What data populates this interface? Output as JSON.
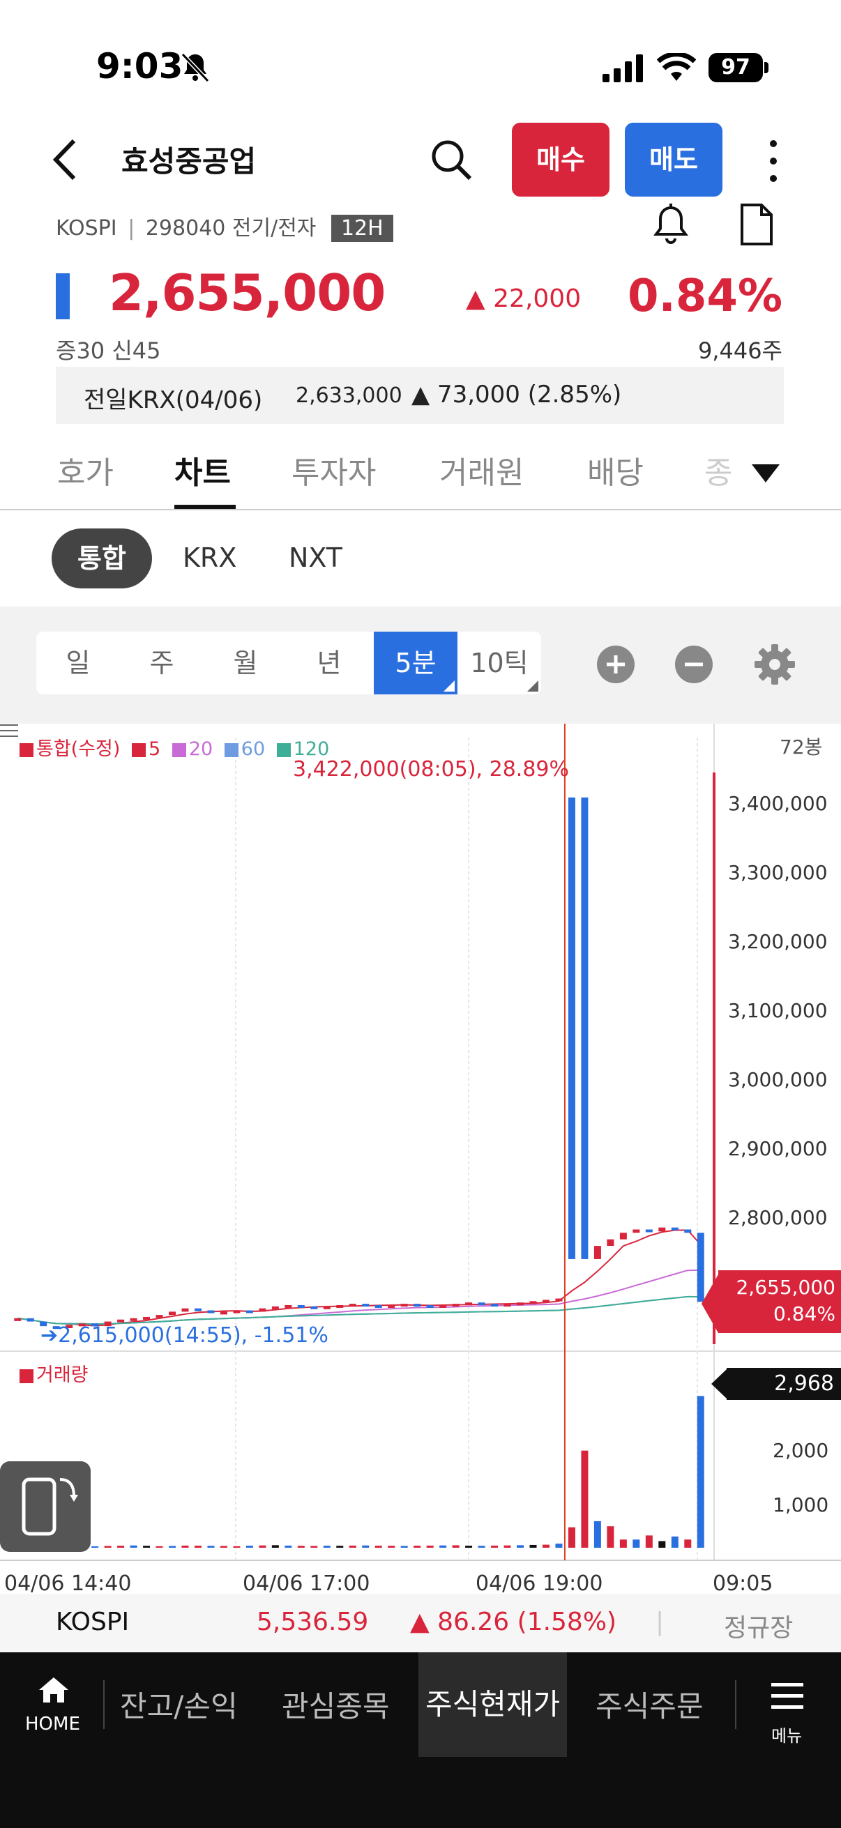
{
  "status": {
    "time": "9:03",
    "battery": "97"
  },
  "header": {
    "title": "효성중공업",
    "buy_label": "매수",
    "sell_label": "매도"
  },
  "sub": {
    "market": "KOSPI",
    "sep": "|",
    "code_sector": "298040 전기/전자",
    "badge": "12H"
  },
  "quote": {
    "price": "2,655,000",
    "change": "▲ 22,000",
    "pct": "0.84%",
    "margin": "증30  신45",
    "volume": "9,446주"
  },
  "prev": {
    "label": "전일KRX(04/06)",
    "price": "2,633,000",
    "change": "▲ 73,000  (2.85%)"
  },
  "tabs": [
    "호가",
    "차트",
    "투자자",
    "거래원",
    "배당",
    "종"
  ],
  "markets": {
    "active": "통합",
    "krx": "KRX",
    "nxt": "NXT"
  },
  "periods": [
    "일",
    "주",
    "월",
    "년",
    "5분",
    "10틱"
  ],
  "chart_data": {
    "type": "candlestick",
    "legend": [
      "통합(수정)",
      "5",
      "20",
      "60",
      "120"
    ],
    "legend_colors": {
      "main": "#d9253b",
      "ma5": "#d9253b",
      "ma20": "#c86bd6",
      "ma60": "#6f9be0",
      "ma120": "#3fae96"
    },
    "bars_label": "72봉",
    "y_ticks": [
      "3,400,000",
      "3,300,000",
      "3,200,000",
      "3,100,000",
      "3,000,000",
      "2,900,000",
      "2,800,000"
    ],
    "ylim": [
      2580000,
      3460000
    ],
    "x_ticks": [
      "04/06 14:40",
      "04/06 17:00",
      "04/06 19:00",
      "09:05"
    ],
    "high_annotation": "3,422,000(08:05), 28.89%",
    "low_annotation": "➔2,615,000(14:55), -1.51%",
    "current_price": "2,655,000",
    "current_pct": "0.84%",
    "volume_label": "거래량",
    "volume_ticks": [
      "2,000",
      "1,000"
    ],
    "volume_current": "2,968",
    "price_series": [
      2630000,
      2625000,
      2618000,
      2615000,
      2620000,
      2622000,
      2618000,
      2625000,
      2628000,
      2630000,
      2632000,
      2635000,
      2640000,
      2645000,
      2642000,
      2638000,
      2640000,
      2642000,
      2640000,
      2645000,
      2648000,
      2650000,
      2648000,
      2645000,
      2648000,
      2650000,
      2652000,
      2650000,
      2648000,
      2650000,
      2652000,
      2650000,
      2648000,
      2650000,
      2652000,
      2654000,
      2652000,
      2650000,
      2652000,
      2654000,
      2656000,
      2658000,
      2660000,
      3422000,
      2720000,
      2740000,
      2750000,
      2760000,
      2765000,
      2762000,
      2768000,
      2765000,
      2760000,
      2655000
    ],
    "volume_series": [
      40,
      35,
      30,
      38,
      42,
      30,
      28,
      35,
      40,
      45,
      38,
      30,
      35,
      42,
      40,
      38,
      35,
      30,
      40,
      45,
      50,
      42,
      38,
      35,
      40,
      38,
      42,
      45,
      40,
      38,
      35,
      40,
      42,
      45,
      48,
      40,
      38,
      42,
      45,
      50,
      55,
      60,
      80,
      400,
      1900,
      520,
      420,
      160,
      160,
      240,
      130,
      220,
      160,
      2968
    ]
  },
  "ticker": {
    "name": "KOSPI",
    "value": "5,536.59",
    "change": "▲ 86.26 (1.58%)",
    "sep": "|",
    "session": "정규장"
  },
  "nav": {
    "home": "HOME",
    "items": [
      "잔고/손익",
      "관심종목",
      "주식현재가",
      "주식주문"
    ],
    "menu": "메뉴"
  }
}
